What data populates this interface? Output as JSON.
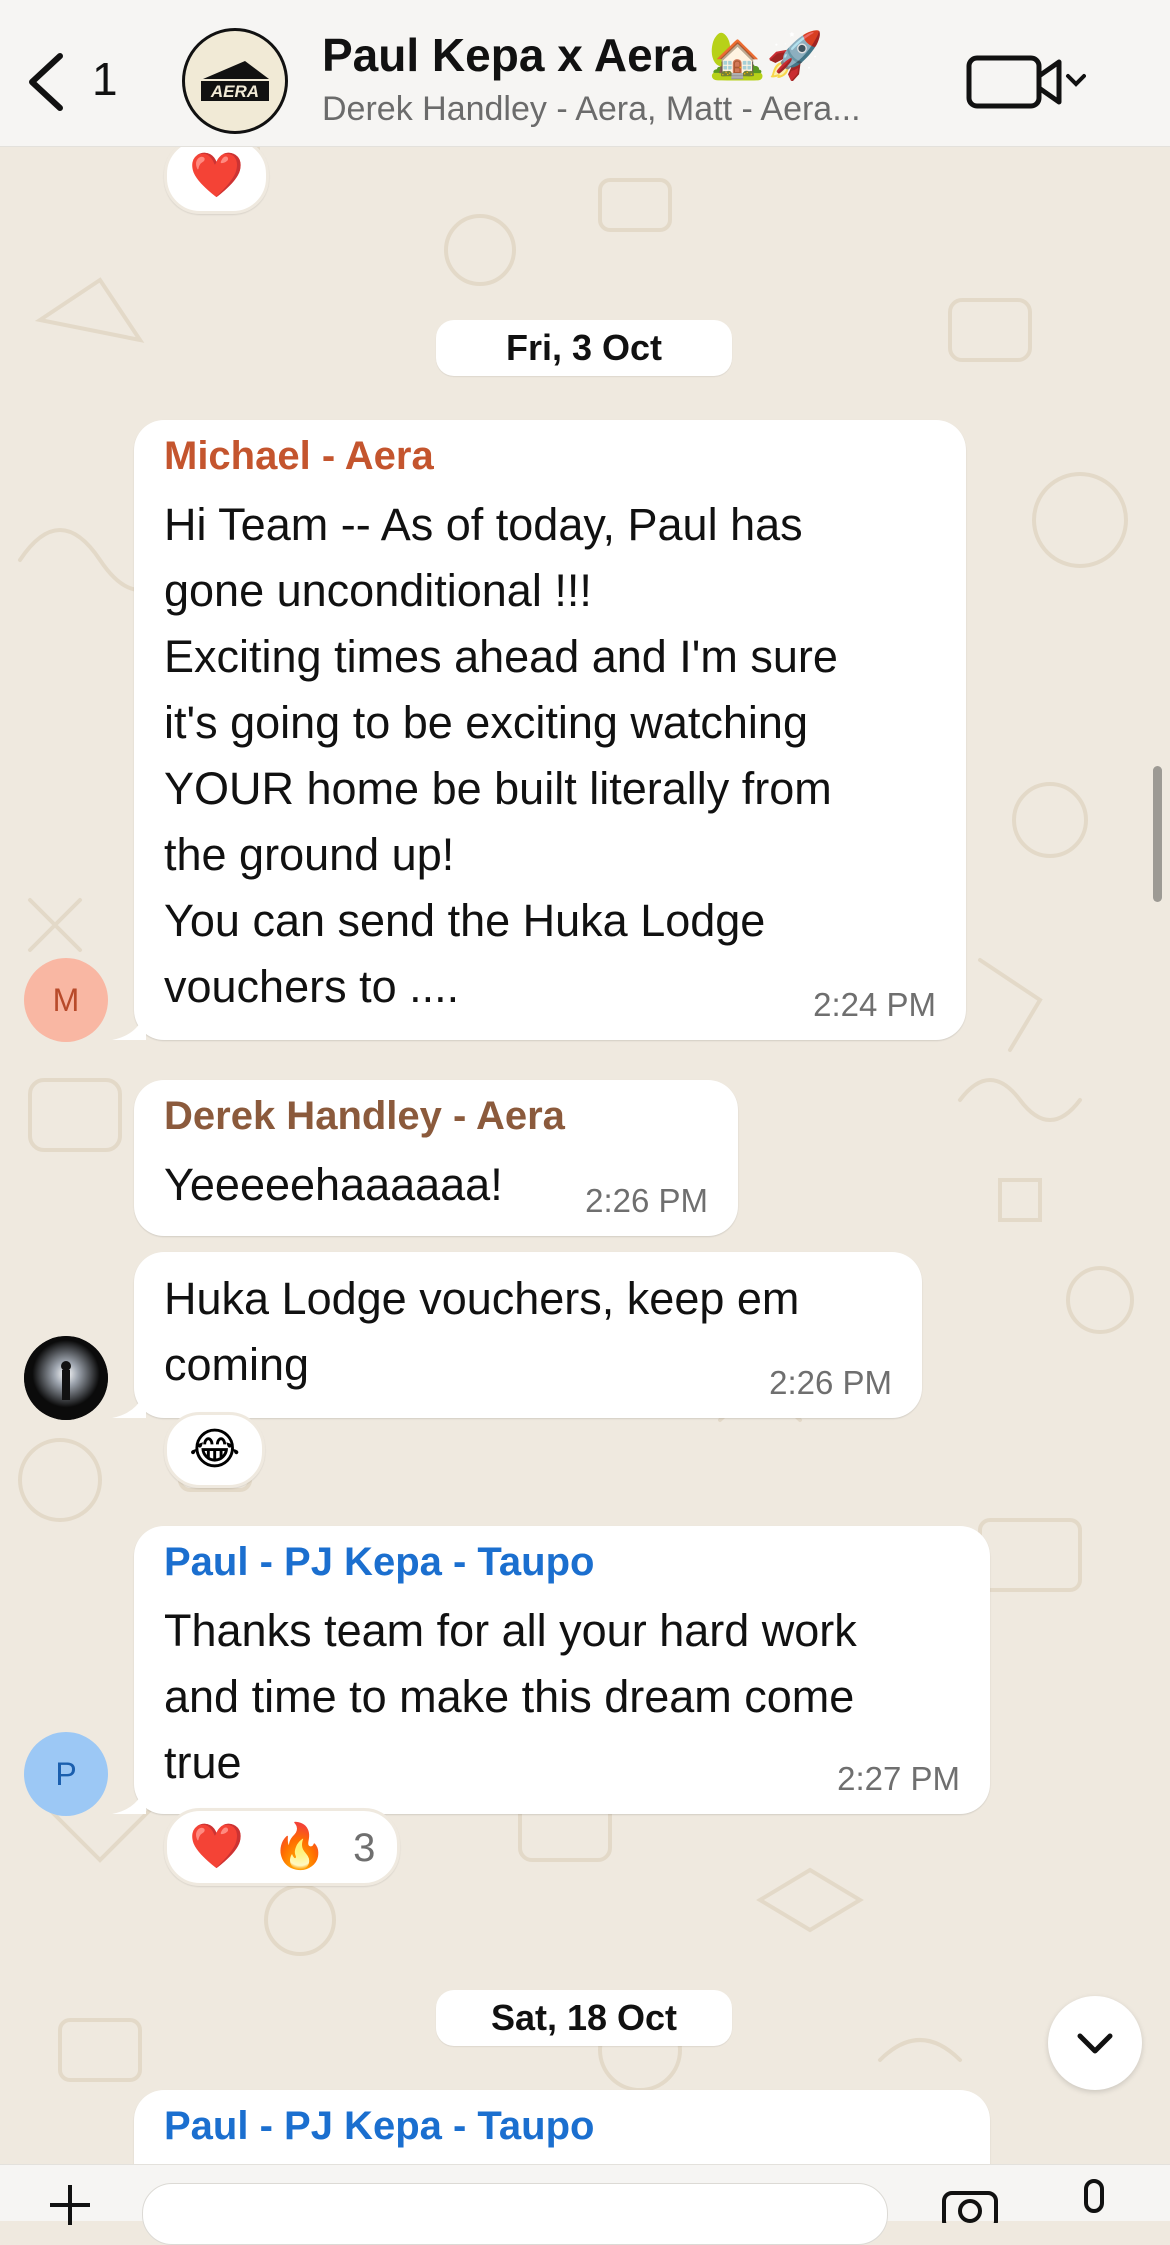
{
  "header": {
    "back_count": "1",
    "title": "Paul Kepa x Aera 🏡🚀",
    "subtitle": "Derek Handley - Aera, Matt - Aera...",
    "group_logo_text": "AERA"
  },
  "top_reaction": {
    "emoji": "❤️"
  },
  "dates": {
    "first": "Fri, 3 Oct",
    "second": "Sat, 18 Oct"
  },
  "messages": [
    {
      "sender": "Michael - Aera",
      "sender_color": "#c4552e",
      "text": "Hi Team -- As of today, Paul has\ngone unconditional !!!\nExciting times ahead and I'm sure\nit's going to be exciting watching\nYOUR home be built literally from\nthe ground up!\nYou can send the Huka Lodge\nvouchers to ....",
      "time": "2:24 PM",
      "avatar_initial": "M"
    },
    {
      "sender": "Derek Handley - Aera",
      "sender_color": "#8b5a3c",
      "text": "Yeeeeehaaaaaa!",
      "time": "2:26 PM"
    },
    {
      "text": "Huka Lodge vouchers, keep em\ncoming",
      "time": "2:26 PM",
      "reaction": "😂"
    },
    {
      "sender": "Paul - PJ Kepa - Taupo",
      "sender_color": "#1b6fcf",
      "text": "Thanks team for all your hard work\nand time to make this dream come\ntrue",
      "time": "2:27 PM",
      "avatar_initial": "P",
      "reactions": [
        "❤️",
        "🔥"
      ],
      "reaction_count": "3"
    },
    {
      "sender": "Paul - PJ Kepa - Taupo",
      "sender_color": "#1b6fcf"
    }
  ]
}
